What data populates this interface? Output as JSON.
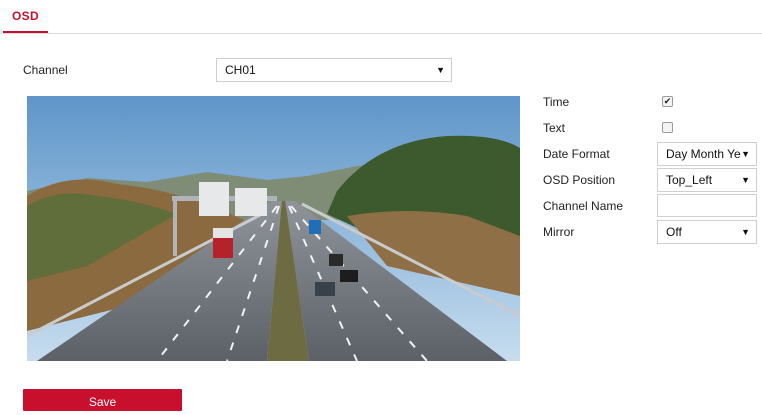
{
  "tabs": [
    {
      "label": "OSD"
    }
  ],
  "channel": {
    "label": "Channel",
    "selected": "CH01"
  },
  "settings": {
    "time": {
      "label": "Time",
      "checked": true
    },
    "text": {
      "label": "Text",
      "checked": false
    },
    "date_format": {
      "label": "Date Format",
      "selected": "Day Month Ye"
    },
    "osd_position": {
      "label": "OSD Position",
      "selected": "Top_Left"
    },
    "channel_name": {
      "label": "Channel Name",
      "value": ""
    },
    "mirror": {
      "label": "Mirror",
      "selected": "Off"
    }
  },
  "save_label": "Save",
  "colors": {
    "accent": "#c8102e"
  }
}
